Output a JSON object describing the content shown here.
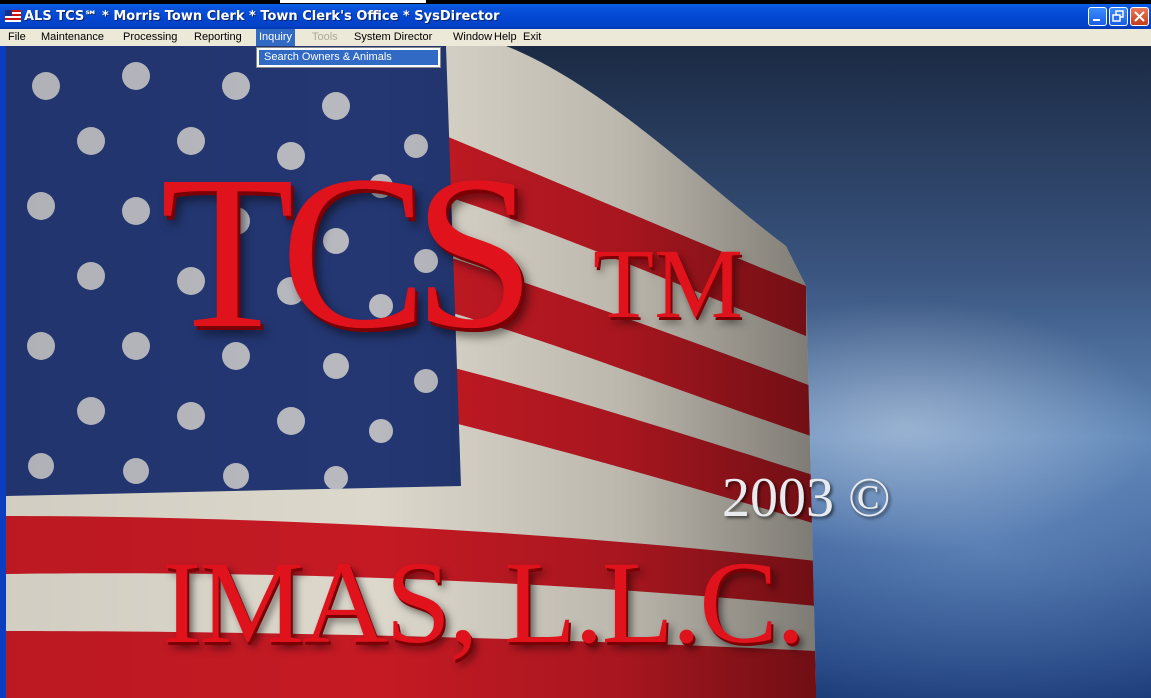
{
  "window": {
    "title": "ALS TCS℠ * Morris Town Clerk * Town Clerk's Office * SysDirector",
    "controls": [
      "minimize-icon",
      "restore-icon",
      "close-icon"
    ]
  },
  "menubar": {
    "items": [
      {
        "label": "File"
      },
      {
        "label": "Maintenance"
      },
      {
        "label": "Processing"
      },
      {
        "label": "Reporting"
      },
      {
        "label": "Inquiry",
        "state": "open"
      },
      {
        "label": "Tools",
        "state": "disabled"
      },
      {
        "label": "System Director"
      },
      {
        "label": "Window"
      },
      {
        "label": "Help"
      },
      {
        "label": "Exit"
      }
    ]
  },
  "inquiry_menu": {
    "items": [
      {
        "label": "Search Owners & Animals",
        "highlighted": true
      }
    ]
  },
  "splash": {
    "product": "TCS",
    "trademark": "TM",
    "year": "2003 ©",
    "company": "IMAS, L.L.C."
  },
  "colors": {
    "titlebar": "#0347d3",
    "menu_highlight": "#316ac5",
    "logo_red": "#e0121c"
  }
}
